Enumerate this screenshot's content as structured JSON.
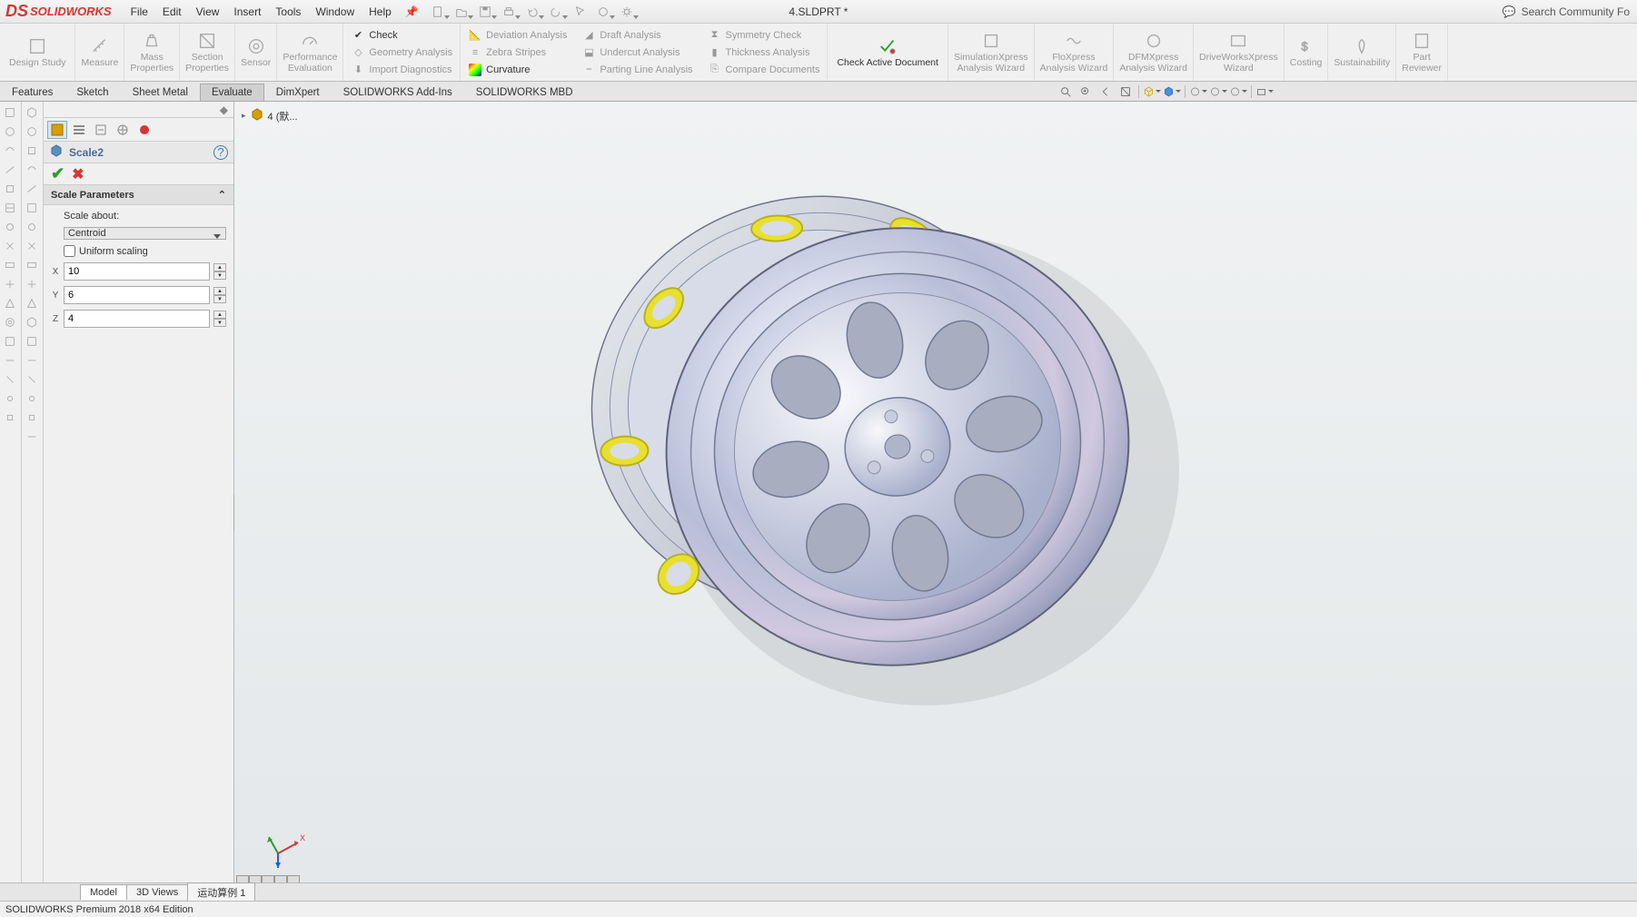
{
  "app": {
    "logo_text": "SOLIDWORKS",
    "document_title": "4.SLDPRT *",
    "search_placeholder": "Search Community Fo",
    "status": "SOLIDWORKS Premium 2018 x64 Edition"
  },
  "menu": [
    "File",
    "Edit",
    "View",
    "Insert",
    "Tools",
    "Window",
    "Help"
  ],
  "ribbon": {
    "large_groups": [
      {
        "label": "Design Study"
      },
      {
        "label": "Measure"
      },
      {
        "label": "Mass\nProperties"
      },
      {
        "label": "Section\nProperties"
      },
      {
        "label": "Sensor"
      },
      {
        "label": "Performance\nEvaluation"
      }
    ],
    "eval_col": [
      {
        "label": "Check",
        "active": true
      },
      {
        "label": "Geometry Analysis"
      },
      {
        "label": "Import Diagnostics"
      }
    ],
    "analysis_col1": [
      {
        "label": "Deviation Analysis"
      },
      {
        "label": "Zebra Stripes"
      },
      {
        "label": "Curvature",
        "active": true,
        "curvature": true
      }
    ],
    "analysis_col2": [
      {
        "label": "Draft Analysis"
      },
      {
        "label": "Undercut Analysis"
      },
      {
        "label": "Parting Line Analysis"
      }
    ],
    "analysis_col3": [
      {
        "label": "Symmetry Check"
      },
      {
        "label": "Thickness Analysis"
      },
      {
        "label": "Compare Documents"
      }
    ],
    "check_active": "Check Active Document",
    "tail_groups": [
      {
        "label": "SimulationXpress\nAnalysis Wizard"
      },
      {
        "label": "FloXpress\nAnalysis Wizard"
      },
      {
        "label": "DFMXpress\nAnalysis Wizard"
      },
      {
        "label": "DriveWorksXpress\nWizard"
      },
      {
        "label": "Costing"
      },
      {
        "label": "Sustainability"
      },
      {
        "label": "Part\nReviewer"
      }
    ]
  },
  "ribbon_tabs": [
    "Features",
    "Sketch",
    "Sheet Metal",
    "Evaluate",
    "DimXpert",
    "SOLIDWORKS Add-Ins",
    "SOLIDWORKS MBD"
  ],
  "ribbon_tab_selected": 3,
  "feature_manager": {
    "title": "Scale2",
    "section_title": "Scale Parameters",
    "scale_about_label": "Scale about:",
    "scale_about_value": "Centroid",
    "uniform_scaling_label": "Uniform scaling",
    "uniform_scaling_checked": false,
    "axes": [
      {
        "axis": "X",
        "value": "10"
      },
      {
        "axis": "Y",
        "value": "6"
      },
      {
        "axis": "Z",
        "value": "4"
      }
    ]
  },
  "breadcrumb": {
    "part_label": "4  (默..."
  },
  "bottom_tabs": [
    "Model",
    "3D Views",
    "运动算例 1"
  ]
}
